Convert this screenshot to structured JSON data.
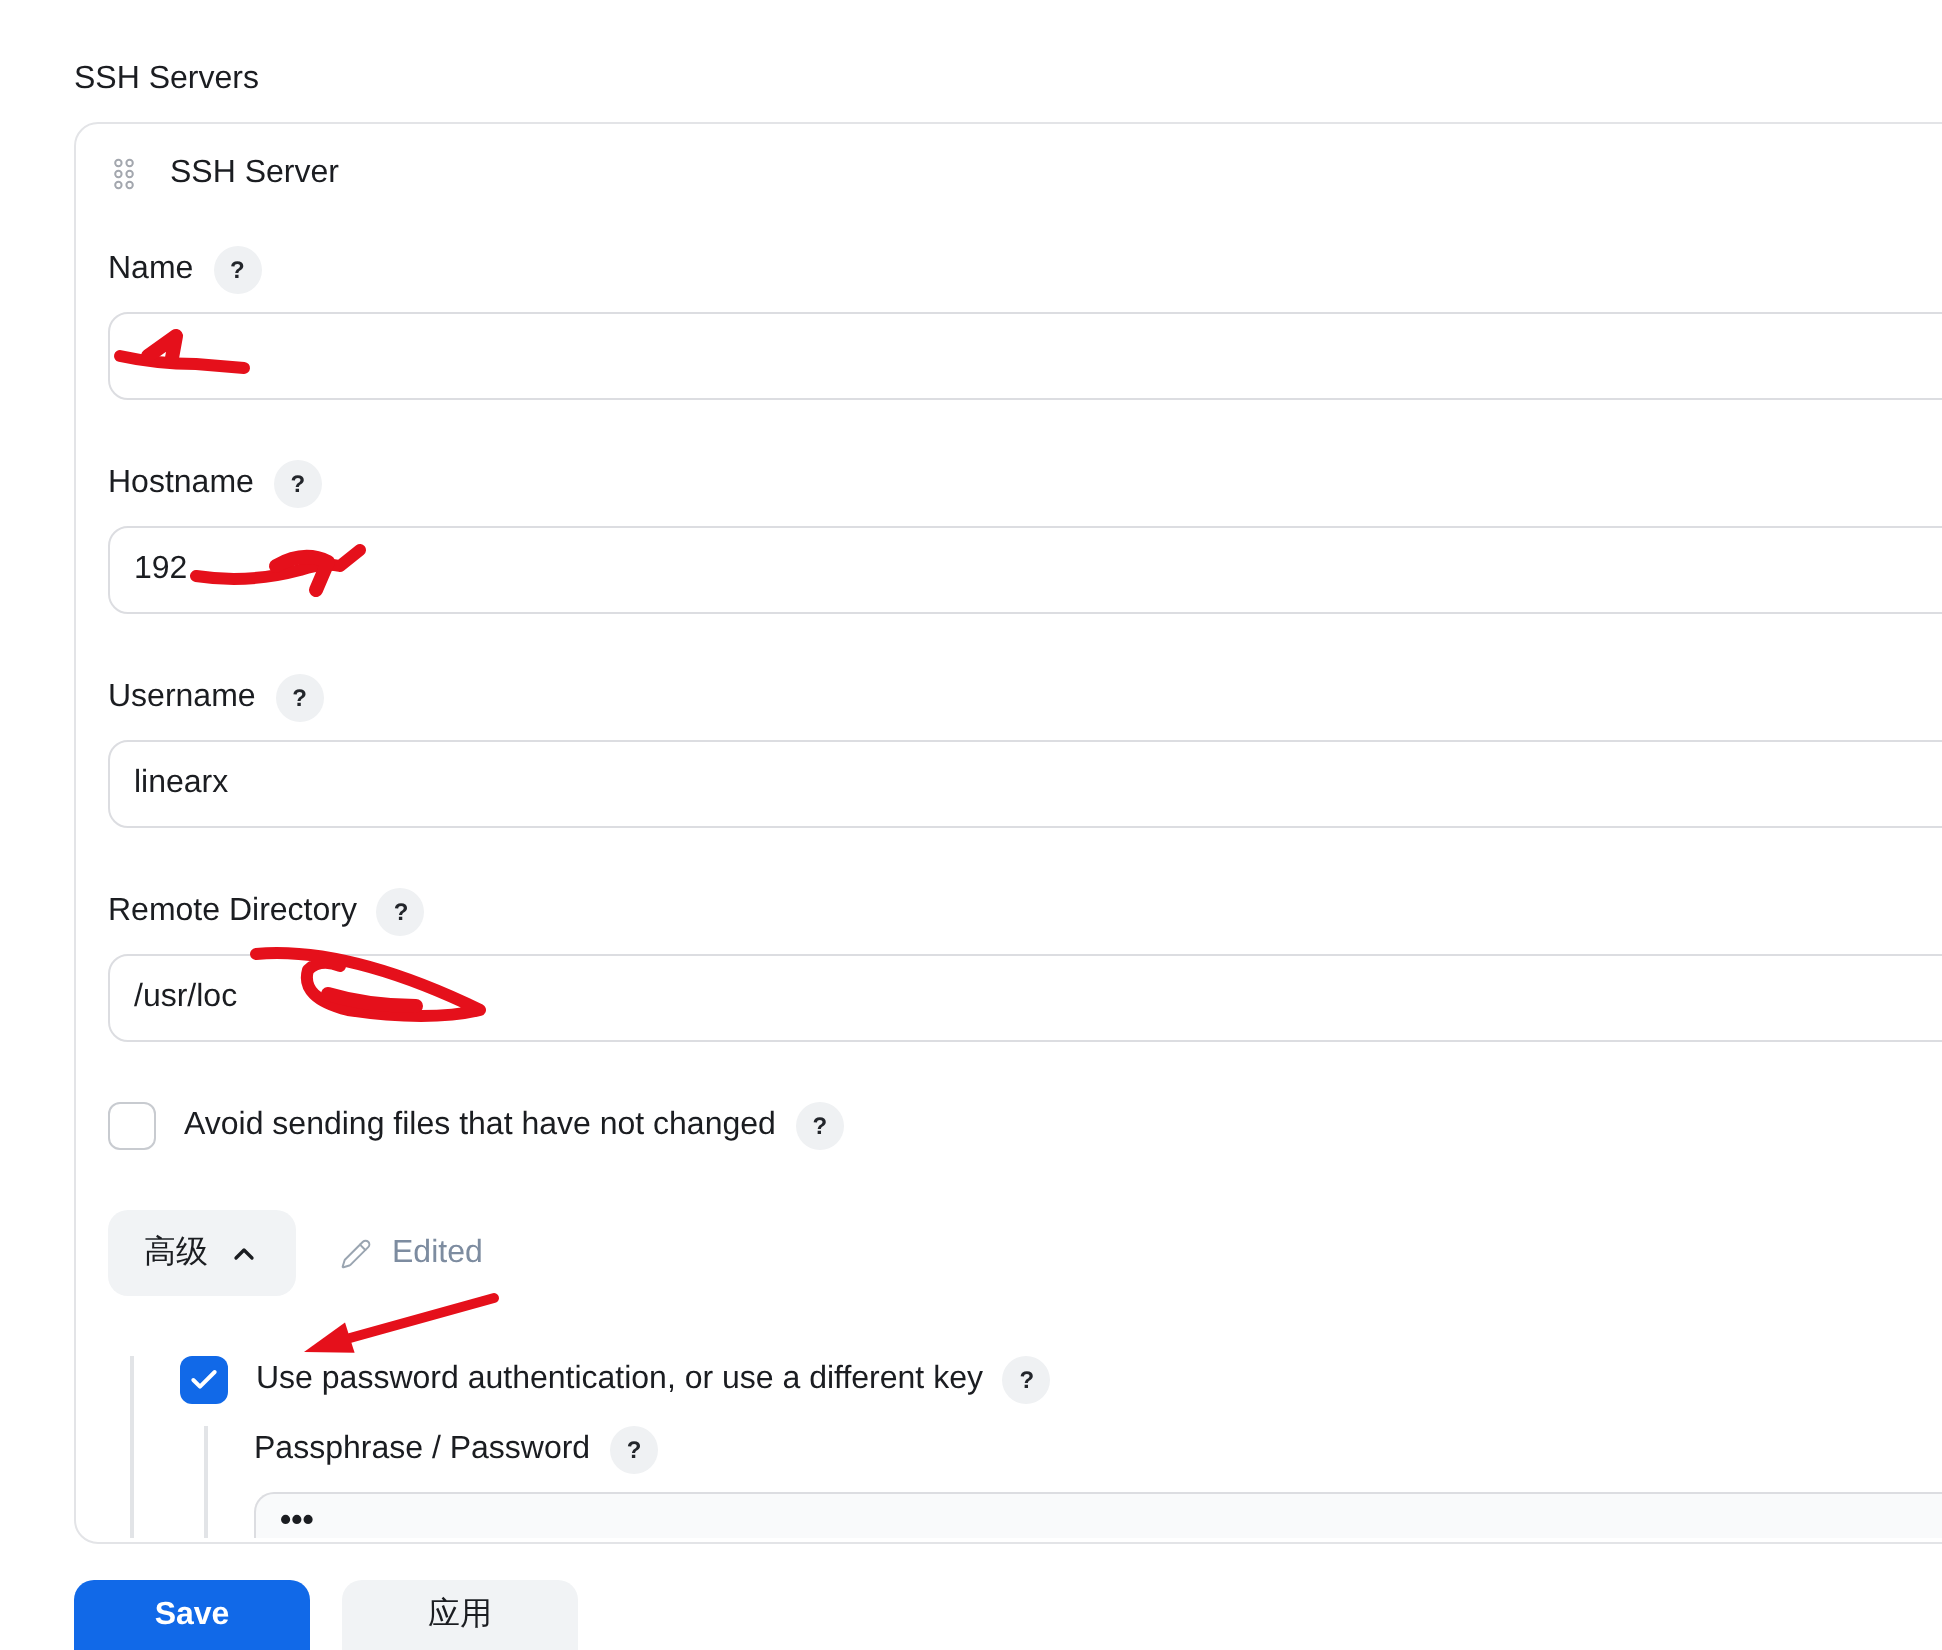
{
  "section": {
    "title": "SSH Servers"
  },
  "server": {
    "title": "SSH Server",
    "fields": [
      {
        "label": "Name",
        "help": "?",
        "redacted": true
      },
      {
        "label": "Hostname",
        "help": "?",
        "value": "192",
        "redacted": true
      },
      {
        "label": "Username",
        "help": "?",
        "value": "linearx"
      },
      {
        "label": "Remote Directory",
        "help": "?",
        "value": "/usr/loc",
        "redacted": true
      }
    ],
    "options": [
      {
        "label": "Avoid sending files that have not changed",
        "help": "?",
        "checked": false
      }
    ],
    "advanced": {
      "label": "高级",
      "expanded": true,
      "edited": "Edited",
      "options": [
        {
          "label": "Use password authentication, or use a different key",
          "help": "?",
          "checked": true,
          "annotated": true,
          "fields": [
            {
              "label": "Passphrase / Password",
              "help": "?",
              "value": "•••"
            }
          ]
        }
      ]
    }
  },
  "buttons": [
    {
      "label": "Save",
      "kind": "primary"
    },
    {
      "label": "应用",
      "kind": "secondary"
    }
  ]
}
